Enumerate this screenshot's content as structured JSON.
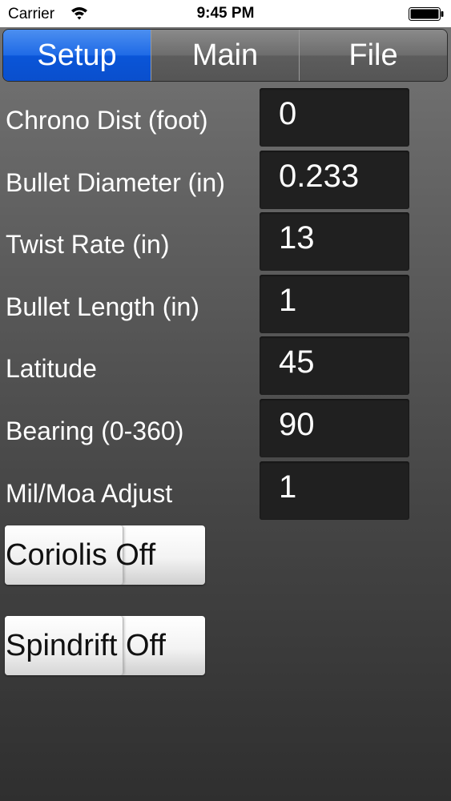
{
  "status_bar": {
    "carrier": "Carrier",
    "time": "9:45 PM"
  },
  "tabs": [
    {
      "label": "Setup",
      "selected": true
    },
    {
      "label": "Main",
      "selected": false
    },
    {
      "label": "File",
      "selected": false
    }
  ],
  "fields": [
    {
      "label": "Chrono Dist (foot)",
      "value": "0"
    },
    {
      "label": "Bullet Diameter (in)",
      "value": "0.233"
    },
    {
      "label": "Twist Rate (in)",
      "value": "13"
    },
    {
      "label": "Bullet Length (in)",
      "value": "1"
    },
    {
      "label": "Latitude",
      "value": "45"
    },
    {
      "label": "Bearing (0-360)",
      "value": "90"
    },
    {
      "label": "Mil/Moa Adjust",
      "value": "1"
    }
  ],
  "toggles": {
    "coriolis": {
      "label": "Coriolis Off",
      "state": "off"
    },
    "spindrift": {
      "label": "Spindrift Off",
      "state": "off"
    }
  },
  "colors": {
    "accent": "#1f6ae6",
    "field_bg": "#202020"
  }
}
